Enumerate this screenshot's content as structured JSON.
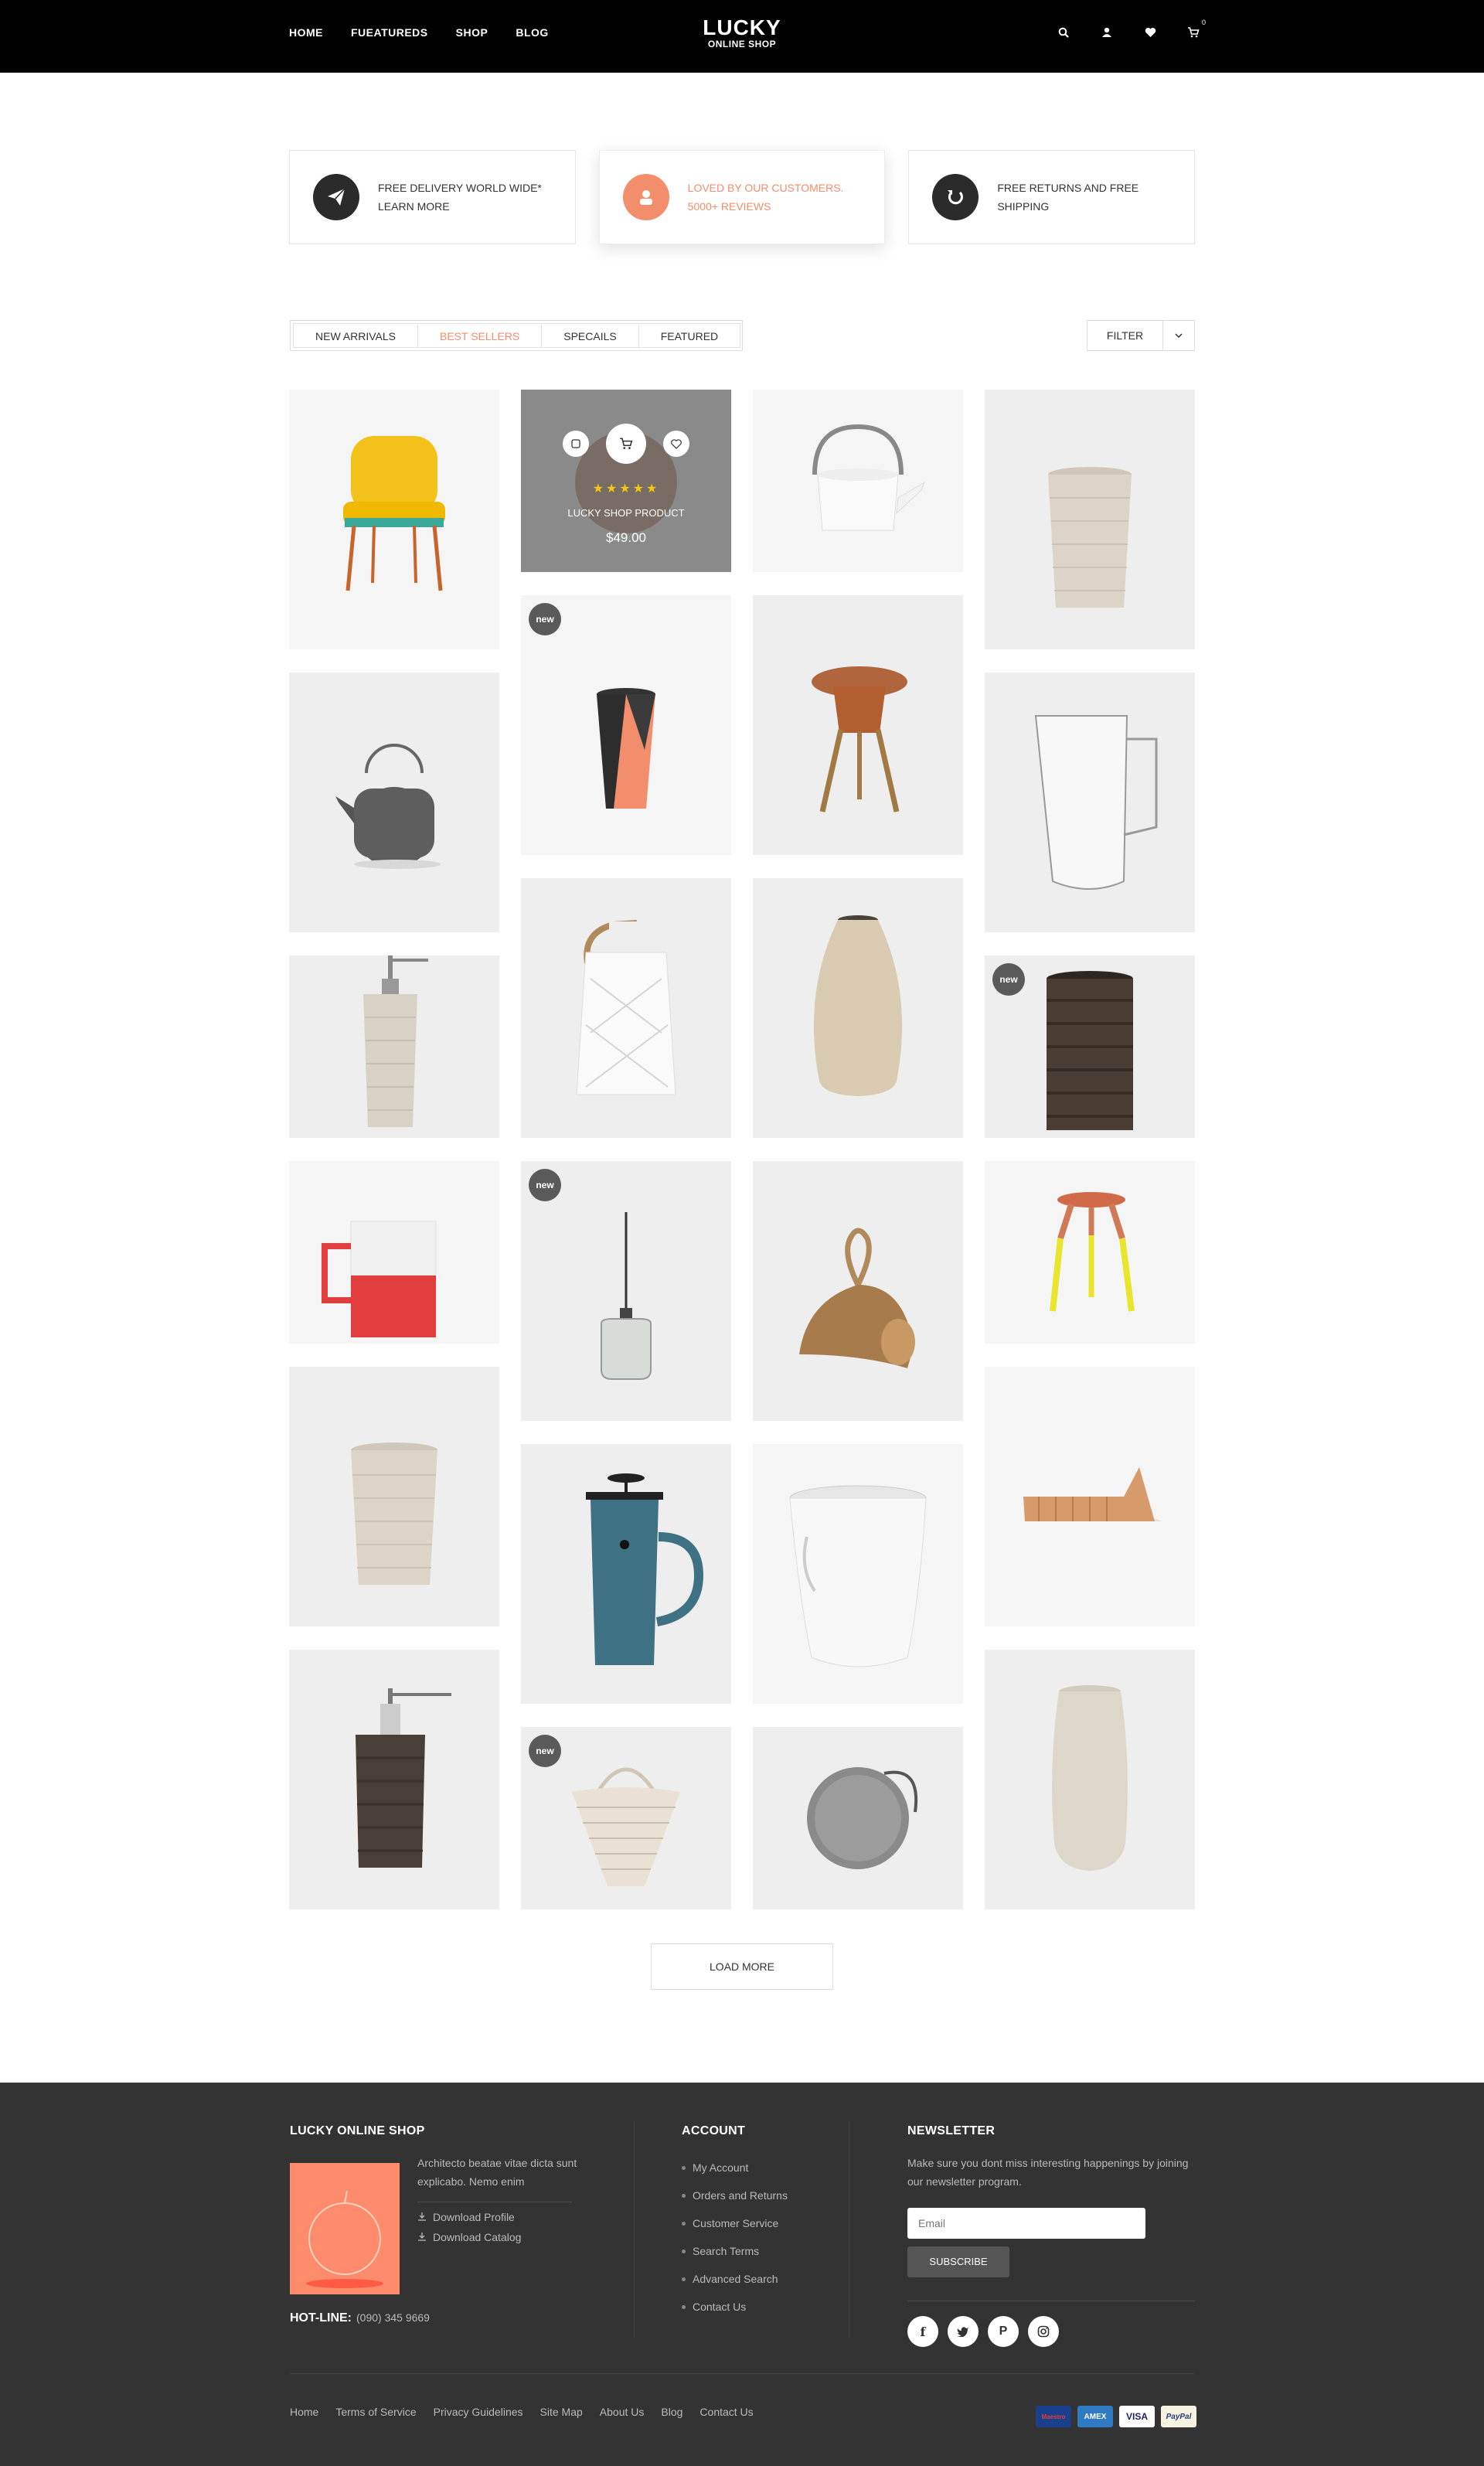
{
  "header": {
    "nav": [
      "HOME",
      "FUEATUREDS",
      "SHOP",
      "BLOG"
    ],
    "logo_line1": "LUCKY",
    "logo_line2": "ONLINE SHOP",
    "cart_count": "0"
  },
  "features": [
    {
      "line1": "FREE DELIVERY WORLD WIDE*",
      "line2": "LEARN MORE",
      "icon": "paper-plane-icon"
    },
    {
      "line1": "LOVED BY OUR CUSTOMERS.",
      "line2": "5000+ REVIEWS",
      "icon": "user-icon"
    },
    {
      "line1": "FREE RETURNS AND FREE",
      "line2": "SHIPPING",
      "icon": "refresh-icon"
    }
  ],
  "tabs": [
    "NEW ARRIVALS",
    "BEST SELLERS",
    "SPECAILS",
    "FEATURED"
  ],
  "active_tab": 1,
  "filter_label": "FILTER",
  "hover_product": {
    "name": "LUCKY SHOP PRODUCT",
    "price": "$49.00",
    "rating": 5
  },
  "badge_new": "new",
  "load_more": "LOAD MORE",
  "colors": {
    "accent": "#f28e6b",
    "header_bg": "#000000",
    "footer_bg": "#333333",
    "card_bg": "#eeeeee"
  },
  "footer": {
    "shop_title": "LUCKY ONLINE SHOP",
    "shop_desc": "Architecto beatae vitae dicta sunt explicabo. Nemo enim",
    "download_profile": "Download Profile",
    "download_catalog": "Download Catalog",
    "hotline_label": "HOT-LINE:",
    "hotline_number": "(090) 345 9669",
    "account_title": "ACCOUNT",
    "account_links": [
      "My Account",
      "Orders and Returns",
      "Customer Service",
      "Search Terms",
      "Advanced Search",
      "Contact Us"
    ],
    "newsletter_title": "NEWSLETTER",
    "newsletter_text": "Make sure you dont miss interesting happenings by joining our newsletter program.",
    "email_placeholder": "Email",
    "subscribe": "SUBSCRIBE",
    "socials": [
      "facebook-icon",
      "twitter-icon",
      "pinterest-icon",
      "instagram-icon"
    ],
    "bottom_links": [
      "Home",
      "Terms of Service",
      "Privacy Guidelines",
      "Site Map",
      "About Us",
      "Blog",
      "Contact Us"
    ],
    "payments": [
      "Maestro",
      "AMEX",
      "VISA",
      "PayPal"
    ]
  }
}
